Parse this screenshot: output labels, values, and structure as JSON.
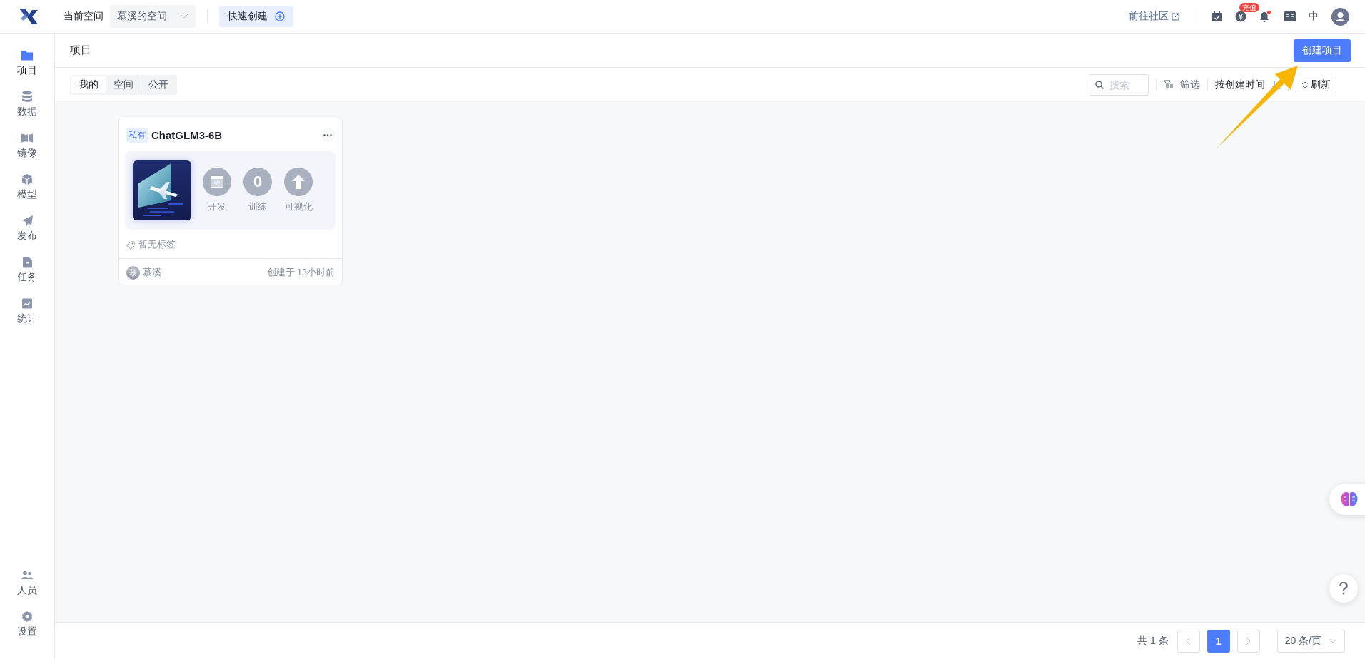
{
  "topbar": {
    "space_label": "当前空间",
    "space_select": "慕溪的空间",
    "quick_create": "快速创建",
    "community_link": "前往社区",
    "recharge_badge": "充值",
    "language": "中"
  },
  "sidebar": {
    "items": [
      {
        "label": "项目",
        "kind": "folder",
        "selected": true
      },
      {
        "label": "数据",
        "kind": "database",
        "selected": false
      },
      {
        "label": "镜像",
        "kind": "mirror",
        "selected": false
      },
      {
        "label": "模型",
        "kind": "cube",
        "selected": false
      },
      {
        "label": "发布",
        "kind": "send",
        "selected": false
      },
      {
        "label": "任务",
        "kind": "file",
        "selected": false
      },
      {
        "label": "统计",
        "kind": "chart",
        "selected": false
      }
    ],
    "bottom_items": [
      {
        "label": "人员",
        "kind": "people",
        "selected": false
      },
      {
        "label": "设置",
        "kind": "gear",
        "selected": false
      }
    ]
  },
  "page": {
    "title": "项目",
    "create_button": "创建项目"
  },
  "filter_tabs": [
    {
      "label": "我的",
      "selected": true
    },
    {
      "label": "空间",
      "selected": false
    },
    {
      "label": "公开",
      "selected": false
    }
  ],
  "search": {
    "placeholder": "搜索"
  },
  "filter_button": "筛选",
  "sort": "按创建时间",
  "refresh_button": "刷新",
  "projects": [
    {
      "visibility": "私有",
      "name": "ChatGLM3-6B",
      "actions": [
        {
          "label": "开发",
          "kind": "code"
        },
        {
          "label": "训练",
          "kind": "count",
          "count": "0"
        },
        {
          "label": "可视化",
          "kind": "upload"
        }
      ],
      "tags": "暂无标签",
      "owner_initial": "慕",
      "owner": "慕溪",
      "created": "创建于 13小时前"
    }
  ],
  "pagination": {
    "total": "共 1 条",
    "pages": [
      {
        "label": "1",
        "selected": true
      }
    ],
    "page_size": "20 条/页"
  }
}
